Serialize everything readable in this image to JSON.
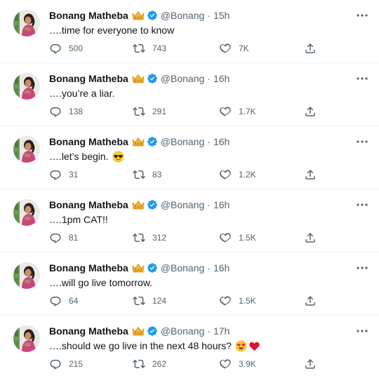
{
  "tweets": [
    {
      "name": "Bonang Matheba",
      "handle": "@Bonang",
      "separator": "·",
      "time": "15h",
      "text": "….time for everyone to know",
      "emojis": [],
      "replies": "500",
      "retweets": "743",
      "likes": "7K"
    },
    {
      "name": "Bonang Matheba",
      "handle": "@Bonang",
      "separator": "·",
      "time": "16h",
      "text": "….you’re a liar.",
      "emojis": [],
      "replies": "138",
      "retweets": "291",
      "likes": "1.7K"
    },
    {
      "name": "Bonang Matheba",
      "handle": "@Bonang",
      "separator": "·",
      "time": "16h",
      "text": "….let’s begin.",
      "emojis": [
        "sunglasses-emoji"
      ],
      "replies": "31",
      "retweets": "83",
      "likes": "1.2K"
    },
    {
      "name": "Bonang Matheba",
      "handle": "@Bonang",
      "separator": "·",
      "time": "16h",
      "text": "….1pm CAT!!",
      "emojis": [],
      "replies": "81",
      "retweets": "312",
      "likes": "1.5K"
    },
    {
      "name": "Bonang Matheba",
      "handle": "@Bonang",
      "separator": "·",
      "time": "16h",
      "text": "….will go live tomorrow.",
      "emojis": [],
      "replies": "64",
      "retweets": "124",
      "likes": "1.5K"
    },
    {
      "name": "Bonang Matheba",
      "handle": "@Bonang",
      "separator": "·",
      "time": "17h",
      "text": "….should we go live in the next 48 hours?",
      "emojis": [
        "heart-eyes-emoji",
        "red-heart-emoji"
      ],
      "replies": "215",
      "retweets": "262",
      "likes": "3.9K"
    }
  ],
  "icons": {
    "name_badge": "crown-icon",
    "verified": "verified-badge-icon",
    "more": "more-options-icon",
    "reply": "reply-icon",
    "retweet": "retweet-icon",
    "like": "like-icon",
    "share": "share-icon"
  },
  "colors": {
    "text": "#0f1419",
    "secondary": "#536471",
    "verified": "#1d9bf0",
    "divider": "#eff3f4"
  }
}
